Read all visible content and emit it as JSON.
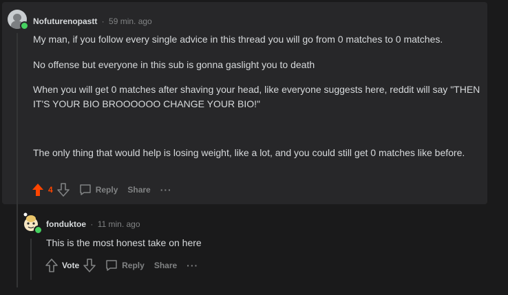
{
  "comment_main": {
    "username": "Nofuturenopastt",
    "separator": "·",
    "time": "59 min. ago",
    "paragraphs": [
      "My man, if you follow every single advice in this thread you will go from 0 matches to 0 matches.",
      "No offense but everyone in this sub is gonna gaslight you to death",
      "When you will get 0 matches after shaving your head, like everyone suggests here, reddit will say \"THEN IT'S YOUR BIO BROOOOOO CHANGE YOUR BIO!\"",
      "The only thing that would help is losing weight, like a lot, and you could still get 0 matches like before."
    ],
    "vote_count": "4",
    "reply_label": "Reply",
    "share_label": "Share",
    "more_label": "···",
    "upvote_color": "#ff4500"
  },
  "comment_reply": {
    "username": "fonduktoe",
    "separator": "·",
    "time": "11 min. ago",
    "text": "This is the most honest take on here",
    "vote_label": "Vote",
    "reply_label": "Reply",
    "share_label": "Share",
    "more_label": "···"
  }
}
